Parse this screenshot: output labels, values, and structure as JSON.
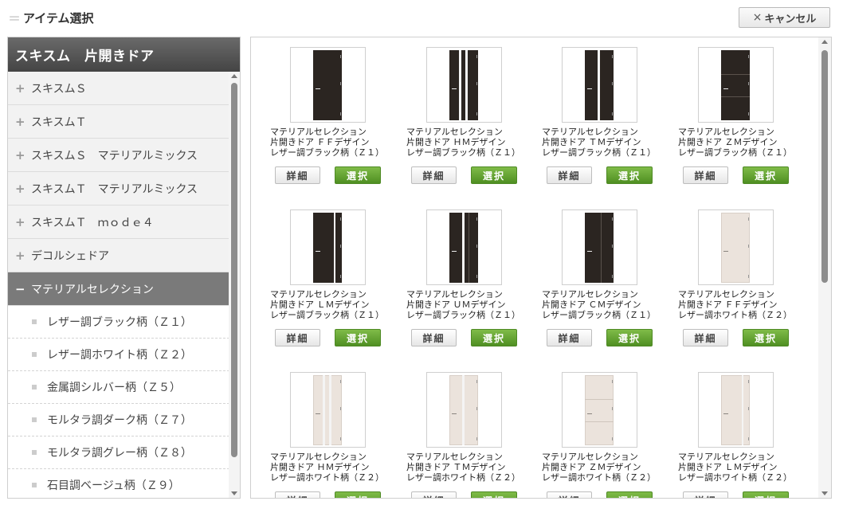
{
  "header": {
    "title": "アイテム選択",
    "cancel_label": "キャンセル"
  },
  "sidebar": {
    "title": "スキスム　片開きドア",
    "items": [
      {
        "label": "スキスムＳ",
        "state": "collapsed"
      },
      {
        "label": "スキスムＴ",
        "state": "collapsed"
      },
      {
        "label": "スキスムＳ　マテリアルミックス",
        "state": "collapsed"
      },
      {
        "label": "スキスムＴ　マテリアルミックス",
        "state": "collapsed"
      },
      {
        "label": "スキスムＴ　ｍｏｄｅ４",
        "state": "collapsed"
      },
      {
        "label": "デコルシェドア",
        "state": "collapsed"
      },
      {
        "label": "マテリアルセレクション",
        "state": "expanded"
      }
    ],
    "subitems": [
      {
        "label": "レザー調ブラック柄（Ｚ１）"
      },
      {
        "label": "レザー調ホワイト柄（Ｚ２）"
      },
      {
        "label": "金属調シルバー柄（Ｚ５）"
      },
      {
        "label": "モルタラ調ダーク柄（Ｚ７）"
      },
      {
        "label": "モルタラ調グレー柄（Ｚ８）"
      },
      {
        "label": "石目調ベージュ柄（Ｚ９）"
      }
    ]
  },
  "products": [
    {
      "line1": "マテリアルセレクション",
      "line2": "片開きドア ＦＦデザイン",
      "line3": "レザー調ブラック柄（Ｚ１）",
      "design": "FF",
      "color": "black"
    },
    {
      "line1": "マテリアルセレクション",
      "line2": "片開きドア ＨＭデザイン",
      "line3": "レザー調ブラック柄（Ｚ１）",
      "design": "HM",
      "color": "black"
    },
    {
      "line1": "マテリアルセレクション",
      "line2": "片開きドア ＴＭデザイン",
      "line3": "レザー調ブラック柄（Ｚ１）",
      "design": "TM",
      "color": "black"
    },
    {
      "line1": "マテリアルセレクション",
      "line2": "片開きドア ＺＭデザイン",
      "line3": "レザー調ブラック柄（Ｚ１）",
      "design": "ZM",
      "color": "black"
    },
    {
      "line1": "マテリアルセレクション",
      "line2": "片開きドア ＬＭデザイン",
      "line3": "レザー調ブラック柄（Ｚ１）",
      "design": "LM",
      "color": "black"
    },
    {
      "line1": "マテリアルセレクション",
      "line2": "片開きドア ＵＭデザイン",
      "line3": "レザー調ブラック柄（Ｚ１）",
      "design": "UM",
      "color": "black"
    },
    {
      "line1": "マテリアルセレクション",
      "line2": "片開きドア ＣＭデザイン",
      "line3": "レザー調ブラック柄（Ｚ１）",
      "design": "CM",
      "color": "black"
    },
    {
      "line1": "マテリアルセレクション",
      "line2": "片開きドア ＦＦデザイン",
      "line3": "レザー調ホワイト柄（Ｚ２）",
      "design": "FF",
      "color": "white"
    },
    {
      "line1": "マテリアルセレクション",
      "line2": "片開きドア ＨＭデザイン",
      "line3": "レザー調ホワイト柄（Ｚ２）",
      "design": "HM",
      "color": "white"
    },
    {
      "line1": "マテリアルセレクション",
      "line2": "片開きドア ＴＭデザイン",
      "line3": "レザー調ホワイト柄（Ｚ２）",
      "design": "TM",
      "color": "white"
    },
    {
      "line1": "マテリアルセレクション",
      "line2": "片開きドア ＺＭデザイン",
      "line3": "レザー調ホワイト柄（Ｚ２）",
      "design": "ZM",
      "color": "white"
    },
    {
      "line1": "マテリアルセレクション",
      "line2": "片開きドア ＬＭデザイン",
      "line3": "レザー調ホワイト柄（Ｚ２）",
      "design": "LM",
      "color": "white"
    }
  ],
  "buttons": {
    "detail_label": "詳細",
    "select_label": "選択"
  },
  "colors": {
    "accent_green": "#5a9a2a",
    "door_black": "#2b2521",
    "door_white": "#ebe3dc",
    "sidebar_header": "#555555",
    "sidebar_active": "#7a7a7a"
  }
}
